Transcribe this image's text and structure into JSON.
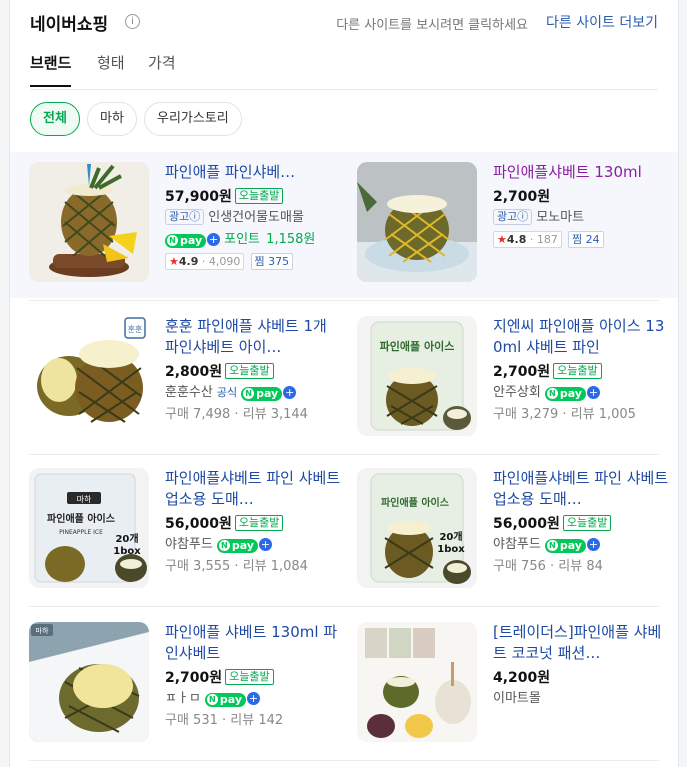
{
  "header": {
    "title": "네이버쇼핑",
    "info_icon": "i",
    "hint": "다른 사이트를 보시려면 클릭하세요",
    "more_link": "다른 사이트 더보기"
  },
  "tabs": [
    {
      "label": "브랜드",
      "active": true
    },
    {
      "label": "형태",
      "active": false
    },
    {
      "label": "가격",
      "active": false
    }
  ],
  "chips": [
    {
      "label": "전체",
      "active": true
    },
    {
      "label": "마하",
      "active": false
    },
    {
      "label": "우리가스토리",
      "active": false
    }
  ],
  "labels": {
    "delivery_tag": "오늘출발",
    "ad_badge": "광고ⓘ",
    "official": "공식",
    "npay": "pay",
    "point_prefix": "포인트",
    "zzim": "찜"
  },
  "products": [
    {
      "name": "파인애플 파인샤베…",
      "price": "57,900원",
      "delivery": true,
      "ad": true,
      "seller": "인생건어물도매몰",
      "npay_point": "1,158원",
      "rating": "4.9",
      "rating_count": "4,090",
      "zzim": "375",
      "visited": false,
      "one_line": true
    },
    {
      "name": "파인애플샤베트 130ml",
      "price": "2,700원",
      "delivery": false,
      "ad": true,
      "seller": "모노마트",
      "rating": "4.8",
      "rating_count": "187",
      "zzim": "24",
      "visited": true,
      "one_line": false
    },
    {
      "name": "훈훈 파인애플 샤베트 1개 파인샤베트 아이…",
      "price": "2,800원",
      "delivery": true,
      "seller": "훈훈수산",
      "official": true,
      "npay": true,
      "buy_count": "구매 7,498",
      "review_count": "리뷰 3,144",
      "visited": false,
      "one_line": false
    },
    {
      "name": "지엔씨 파인애플 아이스 130ml 샤베트 파인",
      "price": "2,700원",
      "delivery": true,
      "seller": "안주상회",
      "npay": true,
      "buy_count": "구매 3,279",
      "review_count": "리뷰 1,005",
      "visited": false,
      "one_line": false
    },
    {
      "name": "파인애플샤베트 파인 샤베트 업소용 도매…",
      "price": "56,000원",
      "delivery": true,
      "seller": "야참푸드",
      "npay": true,
      "buy_count": "구매 3,555",
      "review_count": "리뷰 1,084",
      "visited": false,
      "one_line": false
    },
    {
      "name": "파인애플샤베트 파인 샤베트 업소용 도매…",
      "price": "56,000원",
      "delivery": true,
      "seller": "야참푸드",
      "npay": true,
      "buy_count": "구매 756",
      "review_count": "리뷰 84",
      "visited": false,
      "one_line": false
    },
    {
      "name": "파인애플 샤베트 130ml 파인샤베트",
      "price": "2,700원",
      "delivery": true,
      "seller": "ㅍㅏㅁ",
      "npay": true,
      "buy_count": "구매 531",
      "review_count": "리뷰 142",
      "visited": false,
      "one_line": false
    },
    {
      "name": "[트레이더스]파인애플 샤베트 코코넛 패션…",
      "price": "4,200원",
      "delivery": false,
      "seller": "이마트몰",
      "visited": false,
      "one_line": false
    }
  ],
  "image_labels": {
    "p3_brand": "훈훈",
    "p4_pack": "파인애플 아이스",
    "p5_brand": "마하",
    "p5_pack": "파인애플 아이스",
    "p5_eng": "PINEAPPLE ICE",
    "p5_count": "20개",
    "p5_box": "1box",
    "p6_pack": "파인애플 아이스",
    "p6_count": "20개",
    "p6_box": "1box",
    "p7_logo": "마하"
  },
  "colors": {
    "link_blue": "#1e4aa4",
    "visited_purple": "#8a1fa0",
    "naver_green": "#03c75a",
    "ad_band": "#f5f7fd"
  }
}
